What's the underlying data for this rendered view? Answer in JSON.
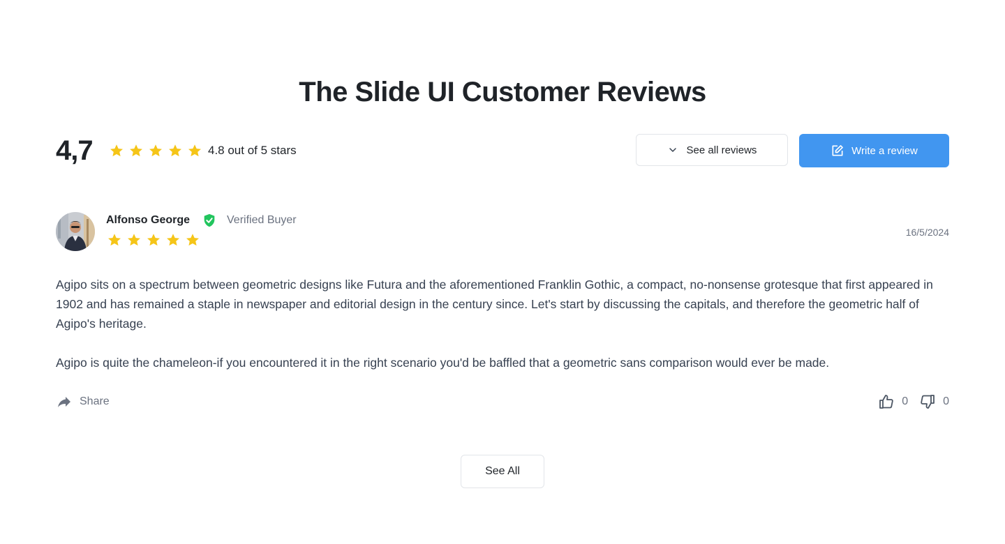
{
  "page": {
    "title": "The Slide UI Customer Reviews"
  },
  "summary": {
    "average": "4,7",
    "stars_text": "4.8 out of 5 stars",
    "star_rating": 5,
    "see_reviews_label": "See all reviews",
    "write_review_label": "Write a review"
  },
  "review": {
    "author": "Alfonso George",
    "verified_label": "Verified Buyer",
    "date": "16/5/2024",
    "rating": 5,
    "paragraphs": [
      "Agipo sits on a spectrum between geometric designs like Futura and the aforementioned Franklin Gothic, a compact, no-nonsense grotesque that first appeared in 1902 and has remained a staple in newspaper and editorial design in the century since. Let's start by discussing the capitals, and therefore the geometric half of Agipo's heritage.",
      "Agipo is quite the chameleon-if you encountered it in the right scenario you'd be baffled that a geometric sans comparison would ever be made."
    ],
    "share_label": "Share",
    "likes": "0",
    "dislikes": "0"
  },
  "footer": {
    "see_all_label": "See All"
  },
  "icons": {
    "star": "star-icon",
    "verified": "shield-check-icon",
    "chevron": "chevron-down-icon",
    "edit": "edit-icon",
    "share": "share-arrow-icon",
    "like": "thumbs-up-icon",
    "dislike": "thumbs-down-icon"
  },
  "colors": {
    "star": "#f5c518",
    "primary": "#4196f0",
    "verified": "#22c55e",
    "muted": "#6b7280",
    "text": "#1f2328"
  }
}
